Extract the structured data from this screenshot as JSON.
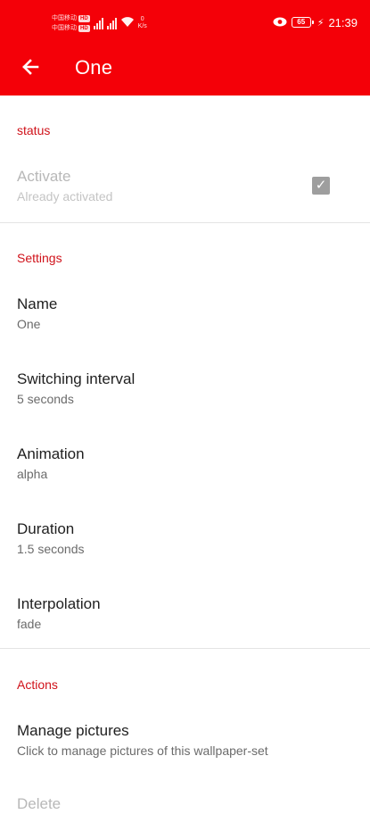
{
  "status_bar": {
    "sim1_label": "中国移动",
    "sim1_badge": "HD",
    "sim2_label": "中国移动",
    "sim2_badge": "HD",
    "network_speed_value": "0",
    "network_speed_unit": "K/s",
    "battery_level": "65",
    "time": "21:39"
  },
  "toolbar": {
    "back_icon": "arrow-left-icon",
    "title": "One"
  },
  "sections": {
    "status": {
      "header": "status",
      "activate_title": "Activate",
      "activate_summary": "Already activated",
      "activate_checked": true
    },
    "settings": {
      "header": "Settings",
      "items": [
        {
          "title": "Name",
          "summary": "One"
        },
        {
          "title": "Switching interval",
          "summary": "5 seconds"
        },
        {
          "title": "Animation",
          "summary": "alpha"
        },
        {
          "title": "Duration",
          "summary": "1.5 seconds"
        },
        {
          "title": "Interpolation",
          "summary": "fade"
        }
      ]
    },
    "actions": {
      "header": "Actions",
      "items": [
        {
          "title": "Manage pictures",
          "summary": "Click to manage pictures of this wallpaper-set"
        },
        {
          "title": "Delete",
          "summary": ""
        }
      ]
    }
  },
  "colors": {
    "app_bar": "#f40008",
    "accent": "#d0121a"
  }
}
